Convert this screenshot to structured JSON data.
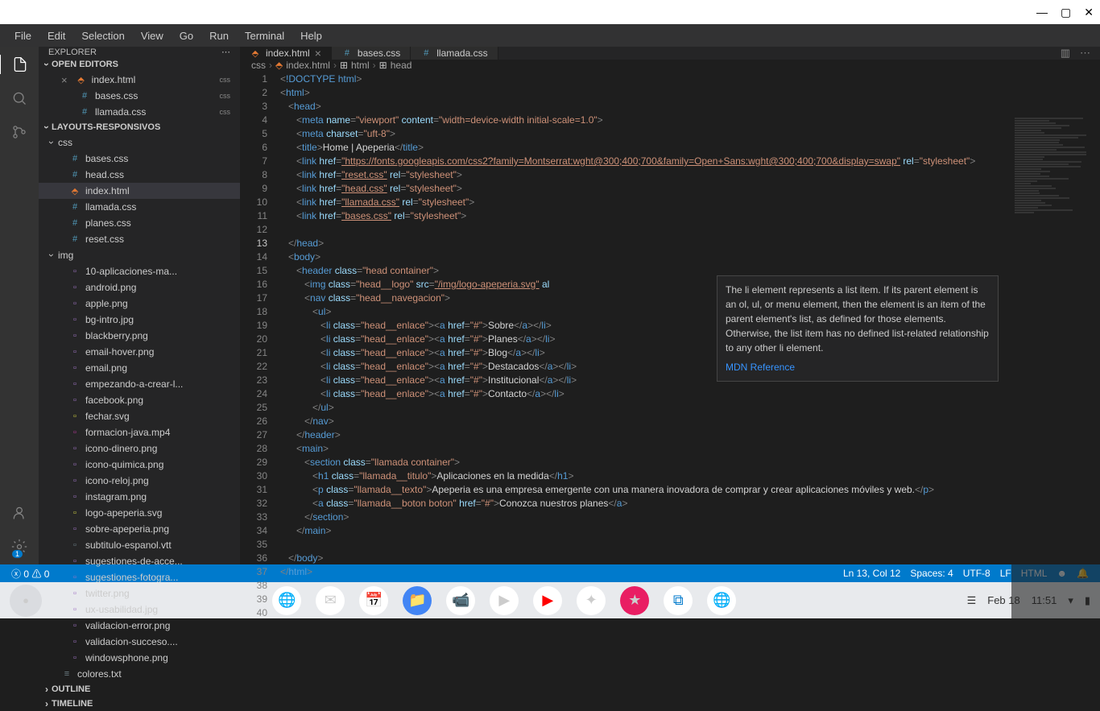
{
  "window": {
    "minimize": "—",
    "maximize": "▢",
    "close": "✕"
  },
  "menu": [
    "File",
    "Edit",
    "Selection",
    "View",
    "Go",
    "Run",
    "Terminal",
    "Help"
  ],
  "sidebar": {
    "title": "EXPLORER",
    "sections": {
      "openEditors": "OPEN EDITORS",
      "workspace": "LAYOUTS-RESPONSIVOS",
      "outline": "OUTLINE",
      "timeline": "TIMELINE"
    },
    "openFiles": [
      {
        "name": "index.html",
        "tag": "css"
      },
      {
        "name": "bases.css",
        "tag": "css"
      },
      {
        "name": "llamada.css",
        "tag": "css"
      }
    ],
    "tree": {
      "cssFolder": "css",
      "cssFiles": [
        "bases.css",
        "head.css",
        "index.html",
        "llamada.css",
        "planes.css",
        "reset.css"
      ],
      "imgFolder": "img",
      "imgFiles": [
        "10-aplicaciones-ma...",
        "android.png",
        "apple.png",
        "bg-intro.jpg",
        "blackberry.png",
        "email-hover.png",
        "email.png",
        "empezando-a-crear-l...",
        "facebook.png",
        "fechar.svg",
        "formacion-java.mp4",
        "icono-dinero.png",
        "icono-quimica.png",
        "icono-reloj.png",
        "instagram.png",
        "logo-apeperia.svg",
        "sobre-apeperia.png",
        "subtitulo-espanol.vtt",
        "sugestiones-de-acce...",
        "sugestiones-fotogra...",
        "twitter.png",
        "ux-usabilidad.jpg",
        "validacion-error.png",
        "validacion-succeso....",
        "windowsphone.png"
      ],
      "rootFile": "colores.txt"
    }
  },
  "tabs": [
    {
      "name": "index.html",
      "active": true
    },
    {
      "name": "bases.css",
      "active": false
    },
    {
      "name": "llamada.css",
      "active": false
    }
  ],
  "breadcrumb": [
    "css",
    "index.html",
    "html",
    "head"
  ],
  "hover": {
    "text": "The li element represents a list item. If its parent element is an ol, ul, or menu element, then the element is an item of the parent element's list, as defined for those elements. Otherwise, the list item has no defined list-related relationship to any other li element.",
    "link": "MDN Reference"
  },
  "statusbar": {
    "left": {
      "errors": "0",
      "warnings": "0"
    },
    "right": {
      "pos": "Ln 13, Col 12",
      "spaces": "Spaces: 4",
      "encoding": "UTF-8",
      "eol": "LF",
      "lang": "HTML"
    }
  },
  "taskbar": {
    "date": "Feb 18",
    "time": "11:51"
  },
  "code": {
    "lines": 40,
    "activeLine": 13,
    "l1_doctype": "!DOCTYPE",
    "l1_html": " html",
    "html": "html",
    "head": "head",
    "meta": "meta",
    "name_attr": "name",
    "viewport": "\"viewport\"",
    "content_attr": "content",
    "content_val": "\"width=device-width initial-scale=1.0\"",
    "charset_attr": "charset",
    "charset_val": "\"uft-8\"",
    "title": "title",
    "title_text": "Home | Apeperia",
    "link": "link",
    "href_attr": "href",
    "rel_attr": "rel",
    "stylesheet": "\"stylesheet\"",
    "font_url": "\"https://fonts.googleapis.com/css2?family=Montserrat:wght@300;400;700&family=Open+Sans:wght@300;400;700&display=swap\"",
    "reset_css": "\"reset.css\"",
    "head_css": "\"head.css\"",
    "llamada_css": "\"llamada.css\"",
    "bases_css": "\"bases.css\"",
    "body": "body",
    "header": "header",
    "class_attr": "class",
    "head_container": "\"head container\"",
    "img": "img",
    "head_logo": "\"head__logo\"",
    "src_attr": "src",
    "logo_src": "\"/img/logo-apeperia.svg\"",
    "al_attr": "al",
    "nav": "nav",
    "head_nav": "\"head__navegacion\"",
    "ul": "ul",
    "li": "li",
    "head_enlace": "\"head__enlace\"",
    "a": "a",
    "hash": "\"#\"",
    "sobre": "Sobre",
    "planes": "Planes",
    "blog": "Blog",
    "destacados": "Destacados",
    "institucional": "Institucional",
    "contacto": "Contacto",
    "main": "main",
    "section": "section",
    "llamada_container": "\"llamada container\"",
    "h1": "h1",
    "llamada_titulo": "\"llamada__titulo\"",
    "h1_text": "Aplicaciones en la medida",
    "p": "p",
    "llamada_texto": "\"llamada__texto\"",
    "p_text": "Apeperia es una empresa emergente con una manera inovadora de comprar y crear aplicaciones móviles y web.",
    "llamada_boton": "\"llamada__boton boton\"",
    "a_text": "Conozca nuestros planes"
  }
}
